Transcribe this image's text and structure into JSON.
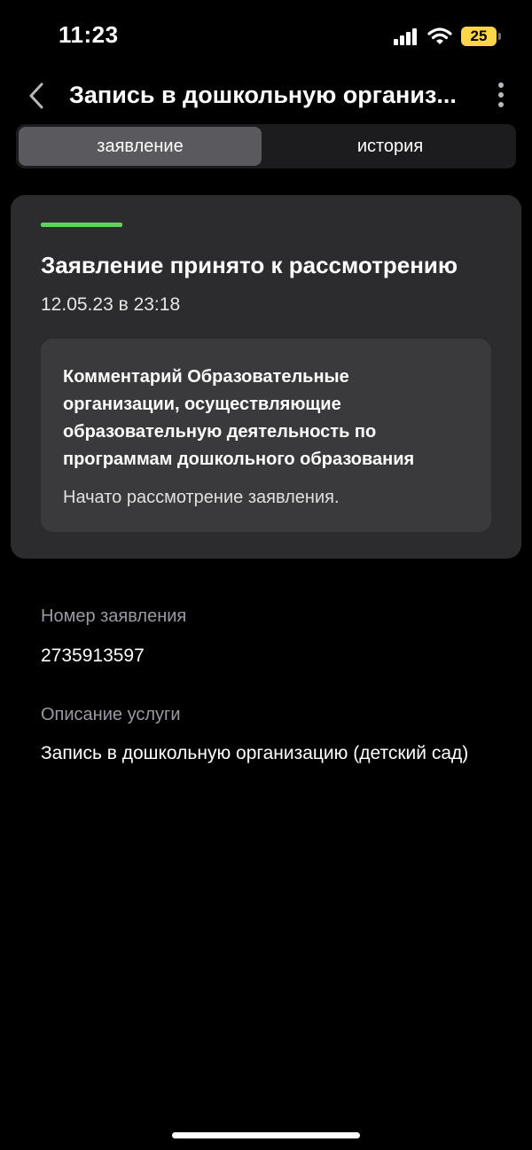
{
  "status_bar": {
    "time": "11:23",
    "battery_level": "25",
    "battery_color": "#ffd54a",
    "icons": [
      "signal-icon",
      "wifi-icon",
      "battery-icon"
    ]
  },
  "header": {
    "title": "Запись в дошкольную организ...",
    "back_icon": "chevron-left-icon",
    "more_icon": "more-vertical-icon"
  },
  "tabs": [
    {
      "label": "заявление",
      "active": true
    },
    {
      "label": "история",
      "active": false
    }
  ],
  "status_card": {
    "accent_color": "#5ed35d",
    "title": "Заявление принято к рассмотрению",
    "date": "12.05.23 в 23:18",
    "comment": {
      "title": "Комментарий Образовательные организации, осуществляющие образовательную деятельность по программам дошкольного образования",
      "text": "Начато рассмотрение заявления."
    }
  },
  "fields": [
    {
      "label": "Номер заявления",
      "value": "2735913597"
    },
    {
      "label": "Описание услуги",
      "value": "Запись в дошкольную организацию (детский сад)"
    }
  ]
}
